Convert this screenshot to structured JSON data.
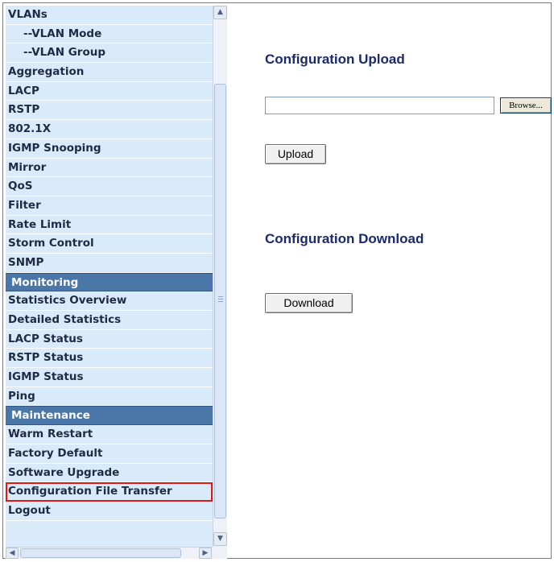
{
  "sidebar": {
    "items": [
      {
        "label": "VLANs",
        "kind": "item"
      },
      {
        "label": "--VLAN Mode",
        "kind": "sub"
      },
      {
        "label": "--VLAN Group",
        "kind": "sub"
      },
      {
        "label": "Aggregation",
        "kind": "item"
      },
      {
        "label": "LACP",
        "kind": "item"
      },
      {
        "label": "RSTP",
        "kind": "item"
      },
      {
        "label": "802.1X",
        "kind": "item"
      },
      {
        "label": "IGMP Snooping",
        "kind": "item"
      },
      {
        "label": "Mirror",
        "kind": "item"
      },
      {
        "label": "QoS",
        "kind": "item"
      },
      {
        "label": "Filter",
        "kind": "item"
      },
      {
        "label": "Rate Limit",
        "kind": "item"
      },
      {
        "label": "Storm Control",
        "kind": "item"
      },
      {
        "label": "SNMP",
        "kind": "item"
      },
      {
        "label": "Monitoring",
        "kind": "header"
      },
      {
        "label": "Statistics Overview",
        "kind": "item"
      },
      {
        "label": "Detailed Statistics",
        "kind": "item"
      },
      {
        "label": "LACP Status",
        "kind": "item"
      },
      {
        "label": "RSTP Status",
        "kind": "item"
      },
      {
        "label": "IGMP Status",
        "kind": "item"
      },
      {
        "label": "Ping",
        "kind": "item"
      },
      {
        "label": "Maintenance",
        "kind": "header"
      },
      {
        "label": "Warm Restart",
        "kind": "item"
      },
      {
        "label": "Factory Default",
        "kind": "item"
      },
      {
        "label": "Software Upgrade",
        "kind": "item"
      },
      {
        "label": "Configuration File Transfer",
        "kind": "item",
        "selected": true
      },
      {
        "label": "Logout",
        "kind": "item"
      }
    ]
  },
  "icons": {
    "scroll_up": "chevron-up-icon",
    "scroll_down": "chevron-down-icon",
    "scroll_left": "chevron-left-icon",
    "scroll_right": "chevron-right-icon"
  },
  "main": {
    "upload_heading": "Configuration Upload",
    "browse_label": "Browse...",
    "upload_label": "Upload",
    "download_heading": "Configuration Download",
    "download_label": "Download"
  },
  "colors": {
    "sidebar_bg": "#d9ebfb",
    "section_header_bg": "#4a76a8",
    "heading_text": "#1a2a6b",
    "selection_outline": "#e01818"
  }
}
